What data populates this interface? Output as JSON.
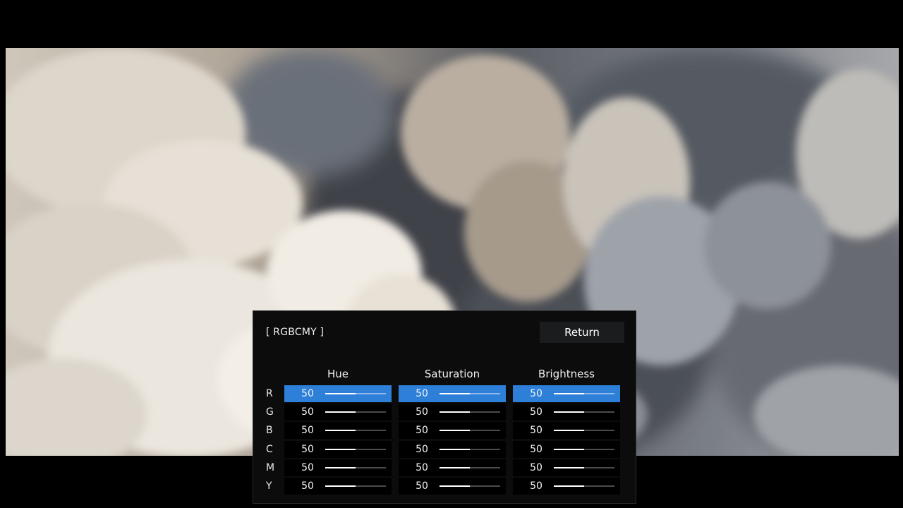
{
  "background": {
    "content": "smoke-clouds-photo"
  },
  "panel": {
    "title": "[ RGBCMY ]",
    "return_label": "Return",
    "columns": [
      "Hue",
      "Saturation",
      "Brightness"
    ],
    "rows": [
      {
        "label": "R",
        "values": [
          50,
          50,
          50
        ]
      },
      {
        "label": "G",
        "values": [
          50,
          50,
          50
        ]
      },
      {
        "label": "B",
        "values": [
          50,
          50,
          50
        ]
      },
      {
        "label": "C",
        "values": [
          50,
          50,
          50
        ]
      },
      {
        "label": "M",
        "values": [
          50,
          50,
          50
        ]
      },
      {
        "label": "Y",
        "values": [
          50,
          50,
          50
        ]
      }
    ],
    "selected_row": 0,
    "value_range": [
      0,
      100
    ],
    "colors": {
      "selected": "#2d7fd8",
      "panel_bg": "#0c0c0d"
    }
  }
}
